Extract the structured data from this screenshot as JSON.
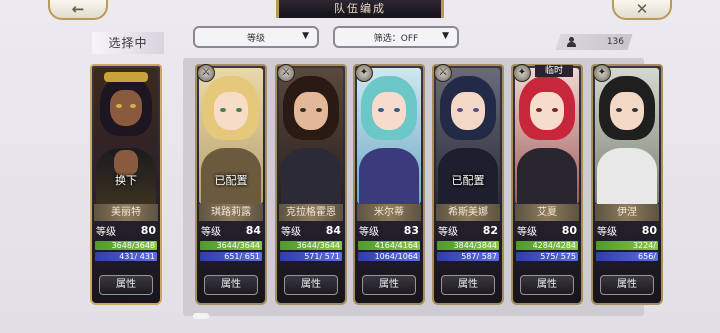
{
  "header": {
    "title": "队伍编成",
    "back_icon": "←",
    "close_icon": "✕"
  },
  "selecting_label": "选择中",
  "sort_dropdown": {
    "label": "等级",
    "arrow": "▼"
  },
  "filter_dropdown": {
    "label": "筛选：OFF",
    "arrow": "▼"
  },
  "unit_count": "136",
  "selected_card": {
    "name": "美丽特",
    "level_label": "等级",
    "level": "80",
    "hp": "3648/3648",
    "sp": "431/ 431",
    "overlay": "换下",
    "attr_label": "属性"
  },
  "cards": [
    {
      "name": "琪路莉露",
      "level_label": "等级",
      "level": "84",
      "hp": "3644/3644",
      "sp": "651/ 651",
      "overlay": "已配置",
      "attr_label": "属性",
      "badge": "⚔",
      "temp": ""
    },
    {
      "name": "克拉格霍恩",
      "level_label": "等级",
      "level": "84",
      "hp": "3644/3644",
      "sp": "571/ 571",
      "overlay": "",
      "attr_label": "属性",
      "badge": "⚔",
      "temp": ""
    },
    {
      "name": "米尔蒂",
      "level_label": "等级",
      "level": "83",
      "hp": "4164/4164",
      "sp": "1064/1064",
      "overlay": "",
      "attr_label": "属性",
      "badge": "✦",
      "temp": ""
    },
    {
      "name": "希斯美娜",
      "level_label": "等级",
      "level": "82",
      "hp": "3844/3844",
      "sp": "587/ 587",
      "overlay": "已配置",
      "attr_label": "属性",
      "badge": "⚔",
      "temp": ""
    },
    {
      "name": "艾夏",
      "level_label": "等级",
      "level": "80",
      "hp": "4284/4284",
      "sp": "575/ 575",
      "overlay": "",
      "attr_label": "属性",
      "badge": "✦",
      "temp": "临时"
    },
    {
      "name": "伊涅",
      "level_label": "等级",
      "level": "80",
      "hp": "3224/",
      "sp": "656/",
      "overlay": "",
      "attr_label": "属性",
      "badge": "✦",
      "temp": ""
    }
  ]
}
